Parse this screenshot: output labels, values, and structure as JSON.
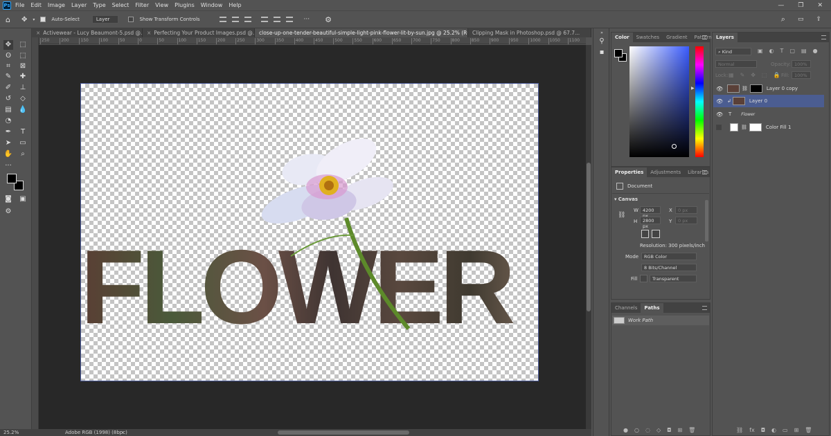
{
  "menu": [
    "File",
    "Edit",
    "Image",
    "Layer",
    "Type",
    "Select",
    "Filter",
    "View",
    "Plugins",
    "Window",
    "Help"
  ],
  "options": {
    "auto_select_label": "Auto-Select",
    "auto_select_target": "Layer",
    "transform_label": "Show Transform Controls"
  },
  "tabs": [
    {
      "label": "Activewear - Lucy Beaumont-5.psd @...",
      "active": false
    },
    {
      "label": "Perfecting Your Product Images.psd @...",
      "active": false
    },
    {
      "label": "close-up-one-tender-beautiful-simple-light-pink-flower-lit-by-sun.jpg @ 25.2% (RGB/8) *",
      "active": true
    },
    {
      "label": "Clipping Mask in Photoshop.psd @ 67.7...",
      "active": false
    }
  ],
  "ruler_ticks": [
    "250",
    "200",
    "150",
    "100",
    "50",
    "0",
    "50",
    "100",
    "150",
    "200",
    "250",
    "300",
    "350",
    "400",
    "450",
    "500",
    "550",
    "600",
    "650",
    "700",
    "750",
    "800",
    "850",
    "900",
    "950",
    "1000",
    "1050",
    "1100"
  ],
  "canvas": {
    "text": "FLOWER"
  },
  "status": {
    "zoom": "25.2%",
    "profile": "Adobe RGB (1998) (8bpc)"
  },
  "color_panel": {
    "tabs": [
      "Color",
      "Swatches",
      "Gradient",
      "Patterns"
    ]
  },
  "properties": {
    "tabs": [
      "Properties",
      "Adjustments",
      "Libraries"
    ],
    "document_label": "Document",
    "section": "Canvas",
    "w_label": "W",
    "w_value": "4200 px",
    "h_label": "H",
    "h_value": "2800 px",
    "x_label": "X",
    "x_value": "0 px",
    "y_label": "Y",
    "y_value": "0 px",
    "resolution": "Resolution: 300 pixels/inch",
    "mode_label": "Mode",
    "mode_value": "RGB Color",
    "bits_value": "8 Bits/Channel",
    "fill_label": "Fill",
    "fill_value": "Transparent"
  },
  "channels": {
    "tabs": [
      "Channels",
      "Paths"
    ],
    "path": "Work Path"
  },
  "layers": {
    "tab": "Layers",
    "kind": "Kind",
    "blend": "Normal",
    "opacity_label": "Opacity:",
    "opacity_value": "100%",
    "lock_label": "Lock:",
    "fill_label": "Fill:",
    "fill_value": "100%",
    "items": [
      {
        "name": "Layer 0 copy",
        "selected": false
      },
      {
        "name": "Layer 0",
        "selected": true
      },
      {
        "name": "Flower",
        "selected": false
      },
      {
        "name": "Color Fill 1",
        "selected": false
      }
    ]
  },
  "colors": {
    "accent": "#4b5d91",
    "panel": "#535353",
    "workspace": "#282828"
  }
}
